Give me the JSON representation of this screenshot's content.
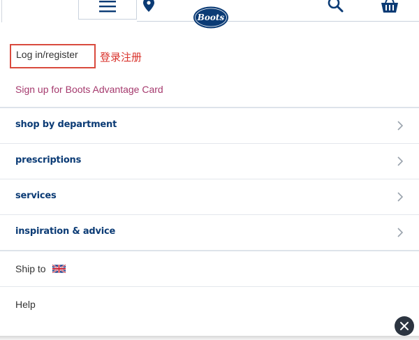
{
  "header": {
    "menu_icon": "hamburger-menu-icon",
    "store_icon": "location-pin-icon",
    "logo_text": "Boots",
    "search_icon": "search-icon",
    "basket_icon": "basket-icon",
    "brand_color": "#0b3b75"
  },
  "account": {
    "login_label": "Log in/register",
    "annotation": "登录注册",
    "signup_label": "Sign up for Boots Advantage Card"
  },
  "nav": {
    "items": [
      {
        "label": "shop by department"
      },
      {
        "label": "prescriptions"
      },
      {
        "label": "services"
      },
      {
        "label": "inspiration & advice"
      }
    ]
  },
  "footer_menu": {
    "ship_to_label": "Ship to",
    "ship_to_flag": "uk-flag-icon",
    "help_label": "Help"
  },
  "close_icon": "close-icon"
}
